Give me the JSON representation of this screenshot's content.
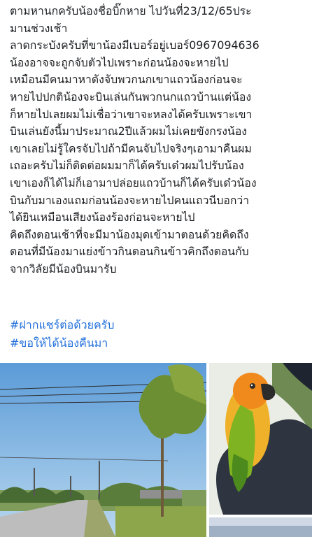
{
  "post": {
    "lines": [
      "ตามหานกครับน้องชื่อบิ๊กหาย ไปวันที่23/12/65ประ",
      "มานช่วงเช้า",
      "ลาดกระบังครับที่ขาน้องมีเบอร์อยู่เบอร์0967094636",
      "น้องอาจจะถูกจับตัวไปเพราะก่อนน้องจะหายไป",
      "เหมือนมีคนมาหาดังจับพวกนกเขาแถวน้องก่อนจะ",
      "หายไปปกติน้องจะบินเล่นกันพวกนกแถวบ้านแต่น้อง",
      "ก็หายไปเลยผมไม่เชื่อว่าเขาจะหลงได้ครับเพราะเขา",
      "บินเล่นยังนี้มาประมาณ2ปีแล้วผมไม่เคยขังกรงน้อง",
      "เขาเลยไม่รู้ใครจับไปถ้ามีคนจับไปจริงๆเอามาคืนผม",
      "เถอะครับไม่ก็ติดต่อผมมาก็ได้ครับเด๋วผมไปรับน้อง",
      "เขาเองก็ได้ไม่ก็เอามาปล่อยแถวบ้านก็ได้ครับเด๋วน้อง",
      "บินกับมาเองแถมก่อนน้องจะหายไปคนแถวนีบอกว่า",
      "ได้ยินเหมือนเสียงน้องร้องก่อนจะหายไป",
      "คิดถึงตอนเช้าที่จะมีมาน้องมุดเข้ามาตอนด้วยคิดถึง",
      "ตอนที่มีน้องมาแย่งข้าวกินตอนกินข้าวคิกถึงตอนกับ",
      "จากวิลัยมีน้องบินมารับ"
    ],
    "hashtags": [
      "#ฝากแชร์ต่อด้วยครับ",
      "#ขอให้ได้น้องคืนมา"
    ]
  },
  "photos": {
    "road": "road-photo",
    "bird": "parrot-photo",
    "third": "third-photo"
  },
  "colors": {
    "text": "#1c1e21",
    "hashtag": "#216fdb",
    "parrot_orange": "#f0a020",
    "parrot_green": "#7fb321"
  }
}
